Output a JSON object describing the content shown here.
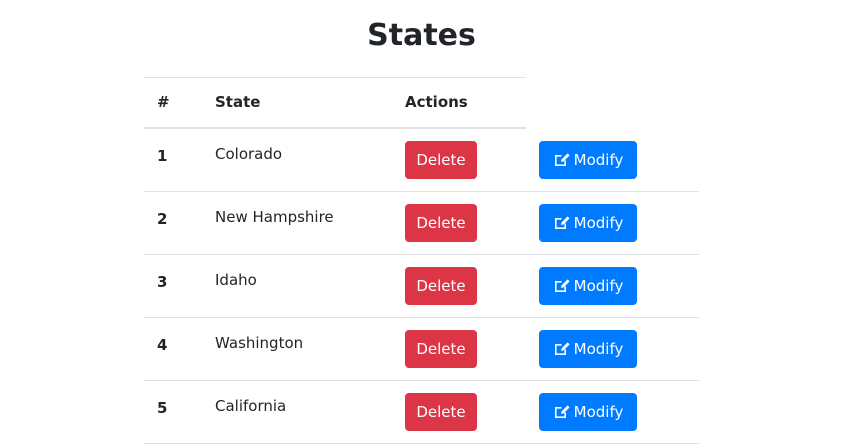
{
  "page_title": "States",
  "table": {
    "headers": {
      "number": "#",
      "state": "State",
      "actions": "Actions"
    },
    "rows": [
      {
        "number": "1",
        "state": "Colorado"
      },
      {
        "number": "2",
        "state": "New Hampshire"
      },
      {
        "number": "3",
        "state": "Idaho"
      },
      {
        "number": "4",
        "state": "Washington"
      },
      {
        "number": "5",
        "state": "California"
      }
    ]
  },
  "buttons": {
    "delete_label": "Delete",
    "modify_label": "Modify",
    "modify_icon": "edit-icon"
  },
  "colors": {
    "delete": "#dc3545",
    "modify": "#007bff",
    "border": "#dee2e6",
    "text": "#212529"
  }
}
